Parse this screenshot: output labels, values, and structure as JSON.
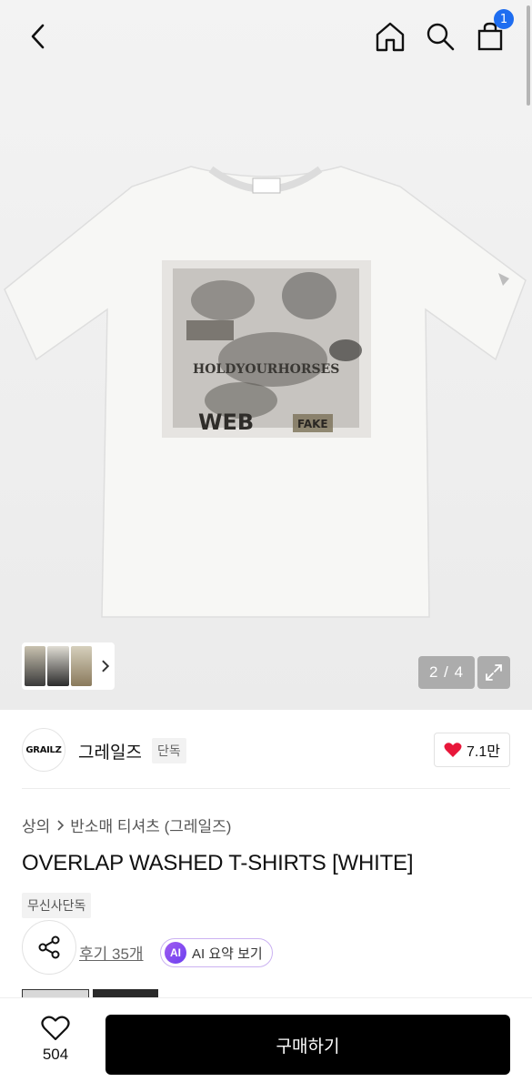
{
  "header": {
    "cart_count": "1",
    "icons": [
      "back-chevron-icon",
      "home-icon",
      "search-icon",
      "shopping-bag-icon"
    ]
  },
  "gallery": {
    "counter": "2 / 4",
    "image_index": 2,
    "image_total": 4,
    "print_texts": [
      "HOLDYOURHORSES",
      "WEB",
      "FAKE"
    ]
  },
  "brand": {
    "logo_text": "GRAILZ",
    "name": "그레일즈",
    "tag": "단독",
    "likes": "7.1만"
  },
  "product": {
    "breadcrumb": [
      "상의",
      "반소매 티셔츠 (그레일즈)"
    ],
    "title": "OVERLAP WASHED T-SHIRTS [WHITE]",
    "tag": "무신사단독",
    "reviews_label": "후기 35개",
    "ai_badge": "AI",
    "ai_summary_label": "AI 요약 보기"
  },
  "bottom_bar": {
    "wish_count": "504",
    "buy_label": "구매하기"
  },
  "colors": {
    "accent_blue": "#1e6df0",
    "heart_red": "#e8173a",
    "buy_button": "#000000",
    "ai_purple": "#8a4cf0"
  }
}
